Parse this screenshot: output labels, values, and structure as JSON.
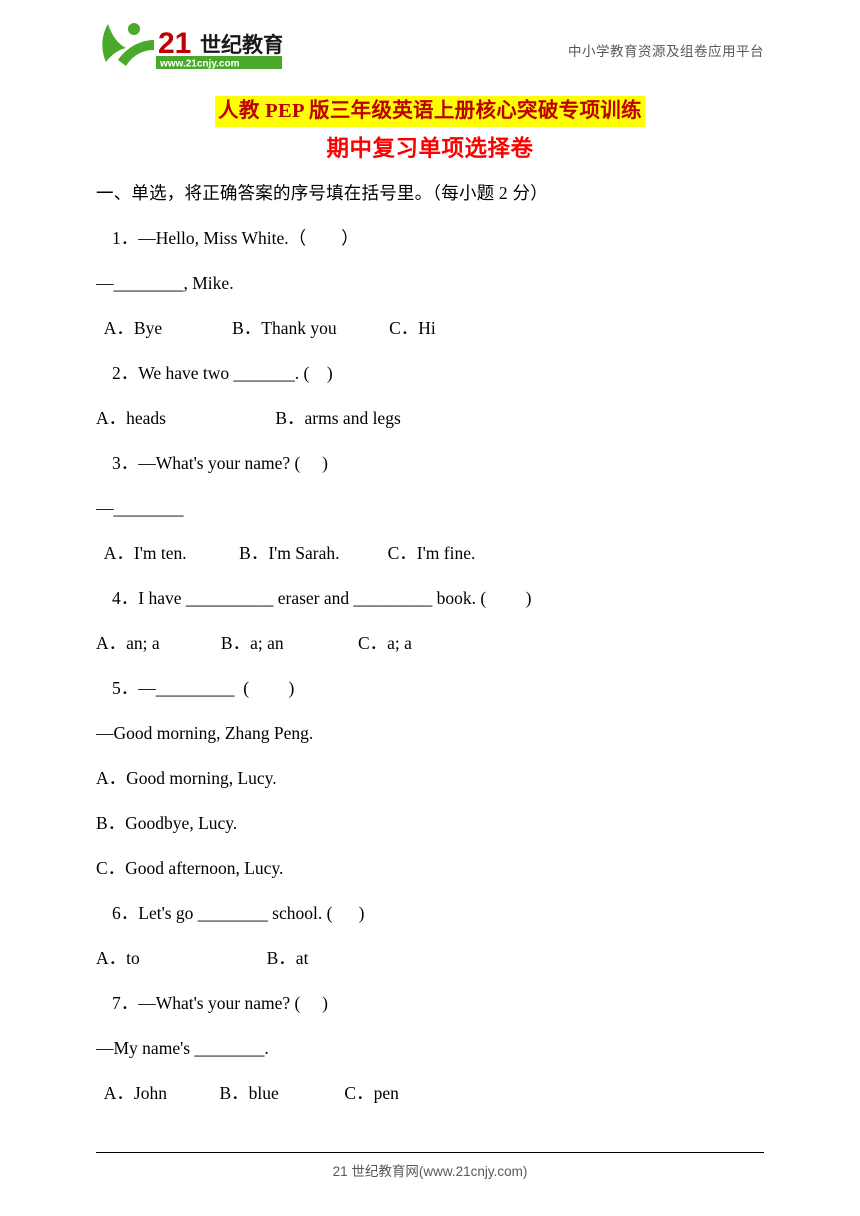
{
  "header": {
    "logo_text": "21世纪教育",
    "logo_sub": "www.21cnjy.com",
    "right_text": "中小学教育资源及组卷应用平台"
  },
  "titles": {
    "main": "人教 PEP 版三年级英语上册核心突破专项训练",
    "sub": "期中复习单项选择卷"
  },
  "section": {
    "heading": "一、单选，将正确答案的序号填在括号里。（每小题 2 分）"
  },
  "questions": [
    {
      "line1": "1．—Hello, Miss White.（        ）",
      "line2": "—________, Mike.",
      "options": "  A．Bye                B．Thank you            C．Hi"
    },
    {
      "line1": "2．We have two _______. (    )",
      "options": "A．heads                         B．arms and legs"
    },
    {
      "line1": "3．—What's your name? (     )",
      "line2": "—________",
      "options": "  A．I'm ten.            B．I'm Sarah.           C．I'm fine."
    },
    {
      "line1": "4．I have __________ eraser and _________ book. (         )",
      "options": "A．an; a              B．a; an                 C．a; a"
    },
    {
      "line1": "5．—_________  (         )",
      "line2": "—Good morning, Zhang Peng.",
      "options_a": "A．Good morning, Lucy.",
      "options_b": "B．Goodbye, Lucy.",
      "options_c": "C．Good afternoon, Lucy."
    },
    {
      "line1": "6．Let's go ________ school. (      )",
      "options": "A．to                             B．at"
    },
    {
      "line1": "7．—What's your name? (     )",
      "line2": "—My name's ________.",
      "options": "  A．John            B．blue               C．pen"
    }
  ],
  "footer": {
    "text": "21 世纪教育网(www.21cnjy.com)"
  }
}
